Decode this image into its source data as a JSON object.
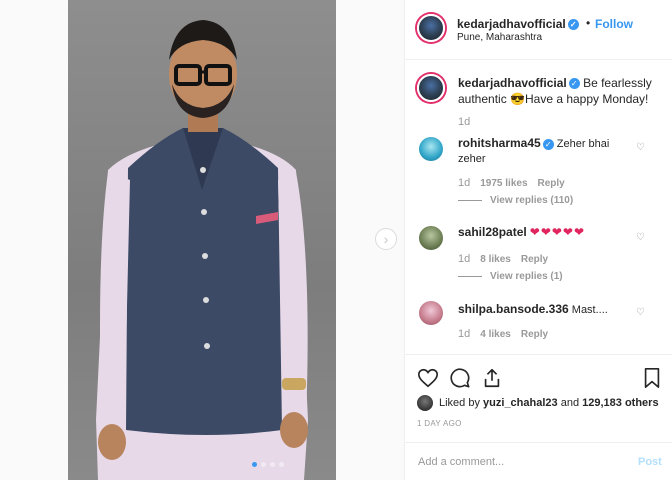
{
  "header": {
    "username": "kedarjadhavofficial",
    "separator": "•",
    "follow_label": "Follow",
    "location": "Pune, Maharashtra"
  },
  "caption": {
    "username": "kedarjadhavofficial",
    "text": "Be fearlessly authentic 😎Have a happy Monday!",
    "time": "1d"
  },
  "comments": [
    {
      "username": "rohitsharma45",
      "text": "Zeher bhai zeher",
      "time": "1d",
      "likes": "1975 likes",
      "reply": "Reply",
      "view_replies": "View replies (110)",
      "verified": true
    },
    {
      "username": "sahil28patel",
      "text": "❤❤❤❤❤",
      "time": "1d",
      "likes": "8 likes",
      "reply": "Reply",
      "view_replies": "View replies (1)",
      "verified": false
    },
    {
      "username": "shilpa.bansode.336",
      "text": "Mast....",
      "time": "1d",
      "likes": "4 likes",
      "reply": "Reply",
      "verified": false
    }
  ],
  "liked_by": {
    "prefix": "Liked by",
    "user": "yuzi_chahal23",
    "conj": "and",
    "others": "129,183 others"
  },
  "time_ago": "1 DAY AGO",
  "add_comment": {
    "placeholder": "Add a comment...",
    "post_label": "Post"
  },
  "carousel": {
    "slides": 4,
    "active": 1
  },
  "icons": {
    "verified": "verified-badge-icon",
    "heart": "heart-icon",
    "comment": "comment-icon",
    "share": "share-icon",
    "save": "bookmark-icon",
    "next": "chevron-right-icon"
  },
  "colors": {
    "accent": "#3897f0",
    "like_red": "#e0245e",
    "muted": "#999999"
  }
}
